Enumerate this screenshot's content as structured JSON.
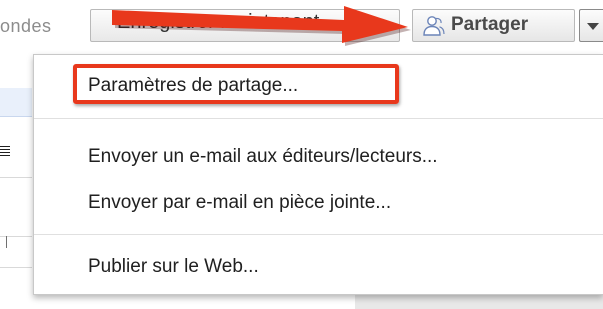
{
  "toolbar": {
    "saved_status_fragment": "ondes",
    "save_button_label": "Enregistrer maintenant",
    "share_button_label": "Partager",
    "share_icon": "person-share-icon",
    "dropdown_icon": "chevron-down-icon"
  },
  "menu": {
    "items": [
      {
        "label": "Paramètres de partage...",
        "highlighted": true
      },
      {
        "label": "Envoyer un e-mail aux éditeurs/lecteurs..."
      },
      {
        "label": "Envoyer par e-mail en pièce jointe..."
      },
      {
        "label": "Publier sur le Web..."
      }
    ]
  },
  "annotations": {
    "arrow_color": "#e8381c",
    "highlight_color": "#e8381c"
  }
}
